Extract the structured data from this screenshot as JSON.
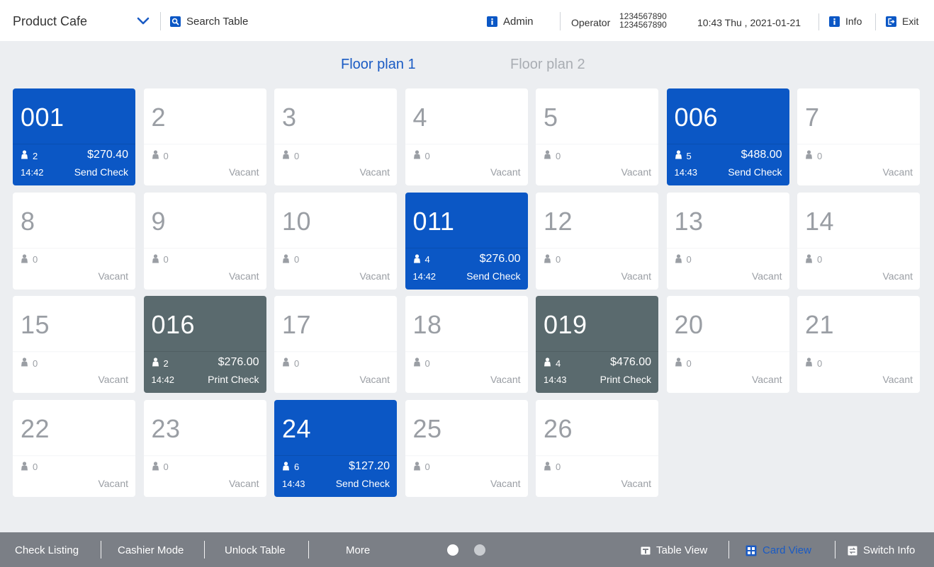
{
  "header": {
    "store_name": "Product Cafe",
    "search_label": "Search Table",
    "admin_label": "Admin",
    "operator_label": "Operator",
    "operator_id_1": "1234567890",
    "operator_id_2": "1234567890",
    "datetime": "10:43 Thu , 2021-01-21",
    "info_label": "Info",
    "exit_label": "Exit"
  },
  "floor_tabs": [
    {
      "label": "Floor plan 1",
      "active": true
    },
    {
      "label": "Floor plan 2",
      "active": false
    }
  ],
  "colors": {
    "accent_blue": "#0b57c5",
    "occupied_gray": "#5a6a6e",
    "bottom_bar": "#7b7f86"
  },
  "tables": [
    {
      "number": "001",
      "state": "blue",
      "guests": "2",
      "amount": "$270.40",
      "time": "14:42",
      "status": "Send Check"
    },
    {
      "number": "2",
      "state": "vacant",
      "guests": "0",
      "status": "Vacant"
    },
    {
      "number": "3",
      "state": "vacant",
      "guests": "0",
      "status": "Vacant"
    },
    {
      "number": "4",
      "state": "vacant",
      "guests": "0",
      "status": "Vacant"
    },
    {
      "number": "5",
      "state": "vacant",
      "guests": "0",
      "status": "Vacant"
    },
    {
      "number": "006",
      "state": "blue",
      "guests": "5",
      "amount": "$488.00",
      "time": "14:43",
      "status": "Send Check"
    },
    {
      "number": "7",
      "state": "vacant",
      "guests": "0",
      "status": "Vacant"
    },
    {
      "number": "8",
      "state": "vacant",
      "guests": "0",
      "status": "Vacant"
    },
    {
      "number": "9",
      "state": "vacant",
      "guests": "0",
      "status": "Vacant"
    },
    {
      "number": "10",
      "state": "vacant",
      "guests": "0",
      "status": "Vacant"
    },
    {
      "number": "011",
      "state": "blue",
      "guests": "4",
      "amount": "$276.00",
      "time": "14:42",
      "status": "Send Check"
    },
    {
      "number": "12",
      "state": "vacant",
      "guests": "0",
      "status": "Vacant"
    },
    {
      "number": "13",
      "state": "vacant",
      "guests": "0",
      "status": "Vacant"
    },
    {
      "number": "14",
      "state": "vacant",
      "guests": "0",
      "status": "Vacant"
    },
    {
      "number": "15",
      "state": "vacant",
      "guests": "0",
      "status": "Vacant"
    },
    {
      "number": "016",
      "state": "gray",
      "guests": "2",
      "amount": "$276.00",
      "time": "14:42",
      "status": "Print Check"
    },
    {
      "number": "17",
      "state": "vacant",
      "guests": "0",
      "status": "Vacant"
    },
    {
      "number": "18",
      "state": "vacant",
      "guests": "0",
      "status": "Vacant"
    },
    {
      "number": "019",
      "state": "gray",
      "guests": "4",
      "amount": "$476.00",
      "time": "14:43",
      "status": "Print Check"
    },
    {
      "number": "20",
      "state": "vacant",
      "guests": "0",
      "status": "Vacant"
    },
    {
      "number": "21",
      "state": "vacant",
      "guests": "0",
      "status": "Vacant"
    },
    {
      "number": "22",
      "state": "vacant",
      "guests": "0",
      "status": "Vacant"
    },
    {
      "number": "23",
      "state": "vacant",
      "guests": "0",
      "status": "Vacant"
    },
    {
      "number": "24",
      "state": "blue",
      "guests": "6",
      "amount": "$127.20",
      "time": "14:43",
      "status": "Send Check"
    },
    {
      "number": "25",
      "state": "vacant",
      "guests": "0",
      "status": "Vacant"
    },
    {
      "number": "26",
      "state": "vacant",
      "guests": "0",
      "status": "Vacant"
    }
  ],
  "footer": {
    "check_listing": "Check Listing",
    "cashier_mode": "Cashier Mode",
    "unlock_table": "Unlock Table",
    "more": "More",
    "table_view": "Table View",
    "card_view": "Card View",
    "switch_info": "Switch Info",
    "active_page": 1,
    "page_count": 2
  }
}
